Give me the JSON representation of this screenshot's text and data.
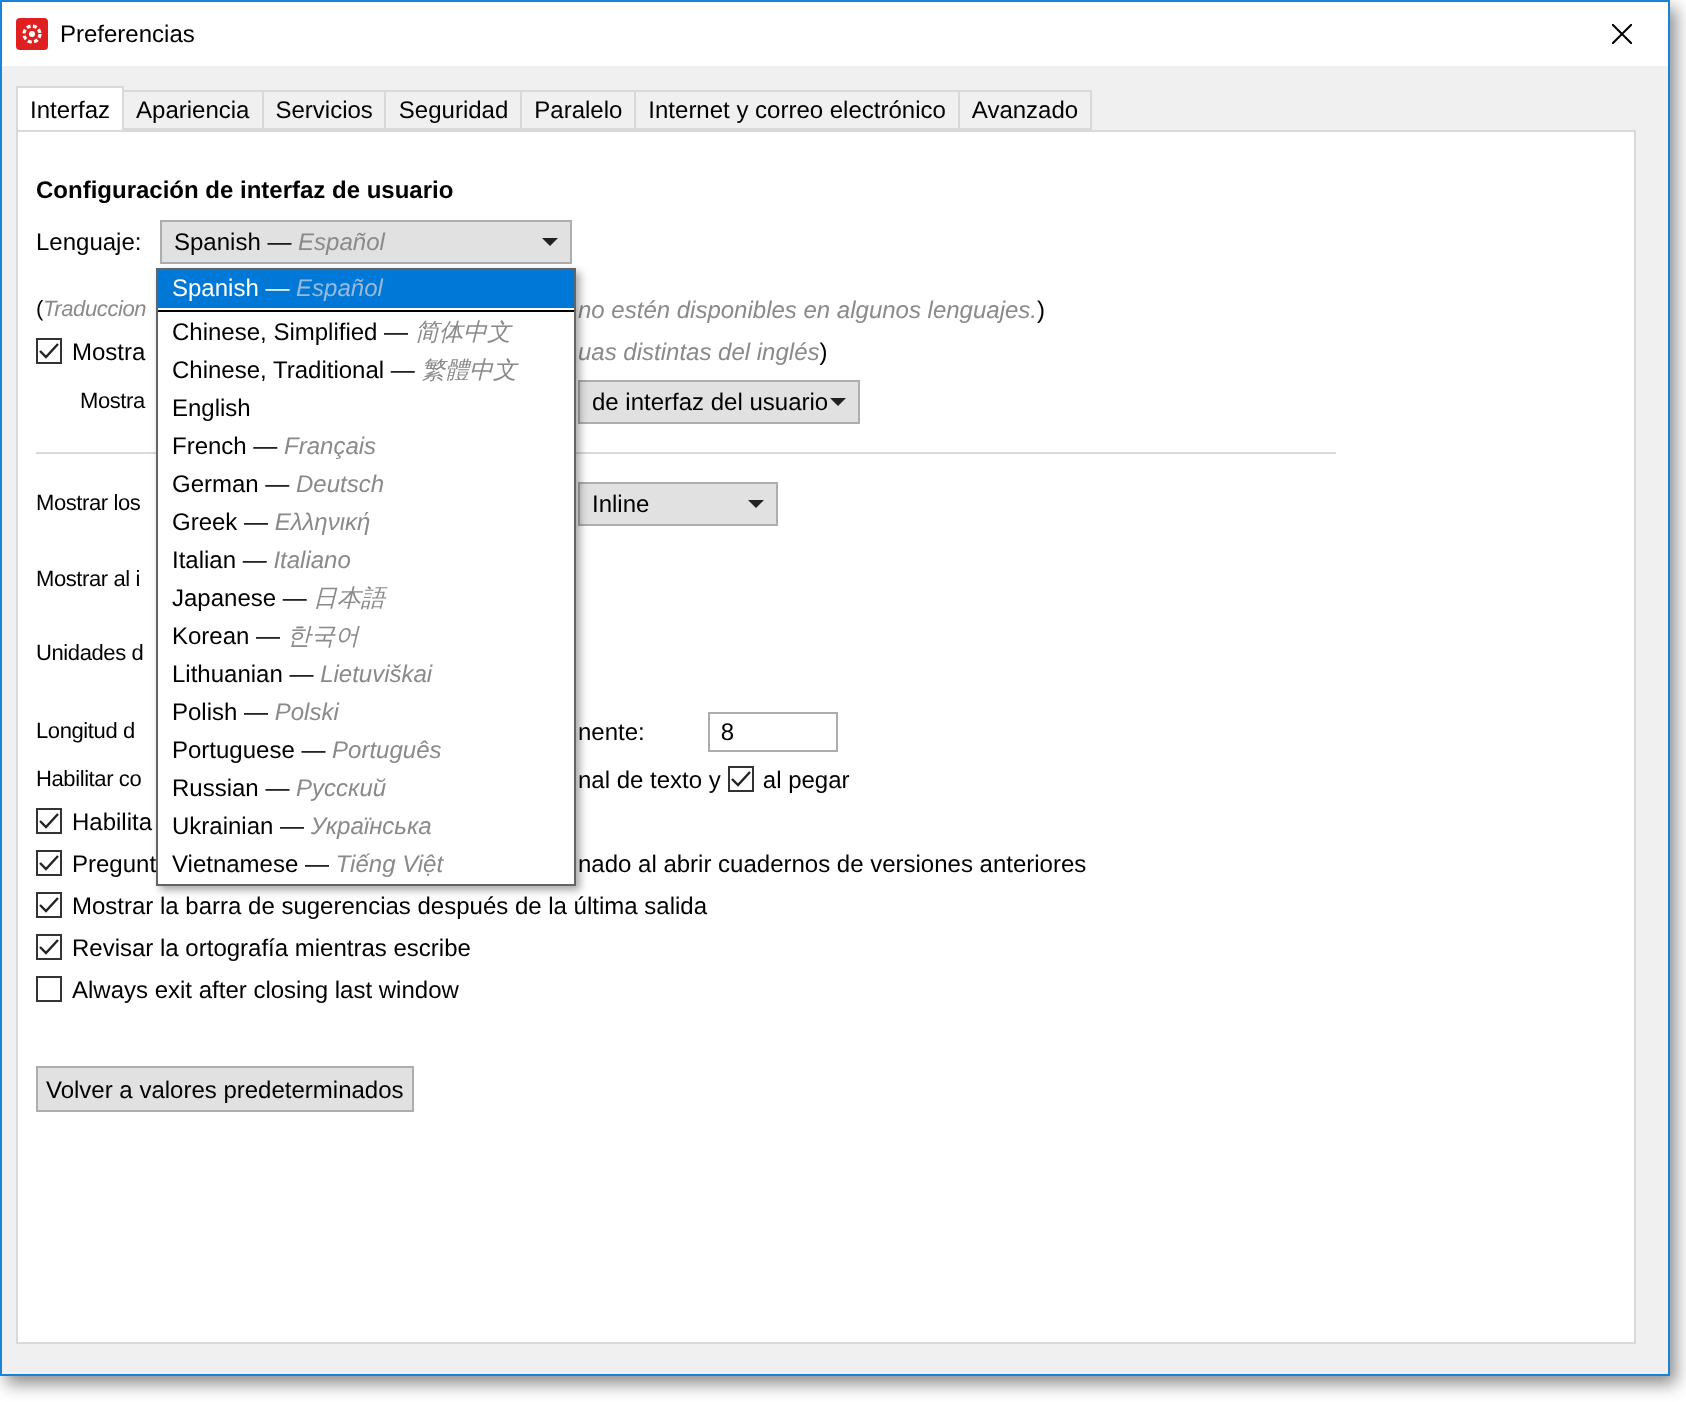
{
  "window": {
    "title": "Preferencias"
  },
  "tabs": [
    {
      "label": "Interfaz",
      "selected": true
    },
    {
      "label": "Apariencia",
      "selected": false
    },
    {
      "label": "Servicios",
      "selected": false
    },
    {
      "label": "Seguridad",
      "selected": false
    },
    {
      "label": "Paralelo",
      "selected": false
    },
    {
      "label": "Internet y correo electrónico",
      "selected": false
    },
    {
      "label": "Avanzado",
      "selected": false
    }
  ],
  "section_title": "Configuración de interfaz de usuario",
  "language": {
    "label": "Lenguaje:",
    "value": "Spanish — *Español*",
    "expanded": true,
    "options": [
      {
        "label": "Spanish — *Español*",
        "selected": true
      },
      {
        "label": "Chinese, Simplified — *简体中文*",
        "selected": false
      },
      {
        "label": "Chinese, Traditional — *繁體中文*",
        "selected": false
      },
      {
        "label": "English",
        "selected": false
      },
      {
        "label": "French — *Français*",
        "selected": false
      },
      {
        "label": "German — *Deutsch*",
        "selected": false
      },
      {
        "label": "Greek — *Ελληνική*",
        "selected": false
      },
      {
        "label": "Italian — *Italiano*",
        "selected": false
      },
      {
        "label": "Japanese — *日本語*",
        "selected": false
      },
      {
        "label": "Korean — *한국어*",
        "selected": false
      },
      {
        "label": "Lithuanian — *Lietuviškai*",
        "selected": false
      },
      {
        "label": "Polish — *Polski*",
        "selected": false
      },
      {
        "label": "Portuguese — *Português*",
        "selected": false
      },
      {
        "label": "Russian — *Русский*",
        "selected": false
      },
      {
        "label": "Ukrainian — *Українська*",
        "selected": false
      },
      {
        "label": "Vietnamese — *Tiếng Việt*",
        "selected": false
      }
    ]
  },
  "upper_rows": [
    {
      "kind": "note",
      "left": "(*Traduccion*",
      "right": "*no estén disponibles en algunos lenguajes.*)"
    },
    {
      "kind": "check",
      "checked": true,
      "left": "Mostra",
      "right": "*uas distintas del inglés*)"
    },
    {
      "kind": "combo",
      "left": "Mostra",
      "value": "de interfaz del usuario"
    }
  ],
  "lower_rows": [
    {
      "kind": "combo",
      "left": "Mostrar los",
      "value": "Inline"
    },
    {
      "kind": "text",
      "left": "Mostrar al i"
    },
    {
      "kind": "text",
      "left": "Unidades d"
    },
    {
      "kind": "input",
      "left": "Longitud d",
      "right": "nente:",
      "value": "8"
    },
    {
      "kind": "text_check",
      "left": "Habilitar co",
      "right": "nal de texto y",
      "checked": true,
      "after": "al pegar"
    },
    {
      "kind": "check",
      "checked": true,
      "left": "Habilita"
    },
    {
      "kind": "check",
      "checked": true,
      "left": "Pregunt",
      "right": "nado al abrir cuadernos de versiones anteriores"
    },
    {
      "kind": "check",
      "checked": true,
      "left": "Mostrar la barra de sugerencias después de la última salida"
    },
    {
      "kind": "check",
      "checked": true,
      "left": "Revisar la ortografía mientras escribe"
    },
    {
      "kind": "check",
      "checked": false,
      "left": "Always exit after closing last window"
    }
  ],
  "reset_button": "Volver a valores predeterminados"
}
